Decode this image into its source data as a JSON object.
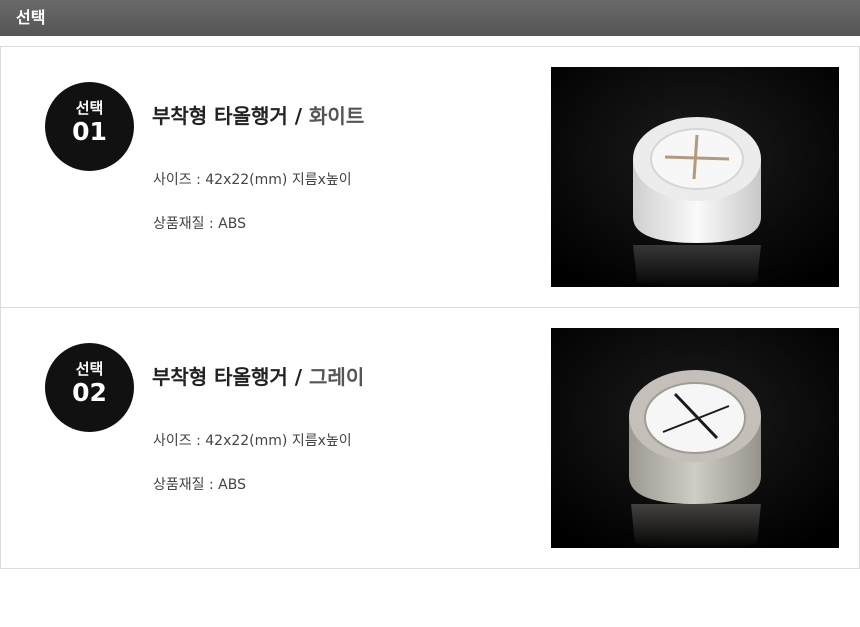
{
  "header": {
    "title": "선택"
  },
  "items": [
    {
      "badge_label": "선택",
      "badge_number": "01",
      "product_name": "부착형 타올행거",
      "separator": "/",
      "variant": "화이트",
      "size_text": "사이즈 : 42x22(mm) 지름x높이",
      "material_text": "상품재질 : ABS",
      "cap_color": "#e9e9e9",
      "face_color": "#f4f4f4",
      "cross_color": "#b39a7d"
    },
    {
      "badge_label": "선택",
      "badge_number": "02",
      "product_name": "부착형 타올행거",
      "separator": "/",
      "variant": "그레이",
      "size_text": "사이즈 : 42x22(mm) 지름x높이",
      "material_text": "상품재질 : ABS",
      "cap_color": "#bdb9b2",
      "face_color": "#f6f6f6",
      "cross_color": "#1a1a1a"
    }
  ]
}
